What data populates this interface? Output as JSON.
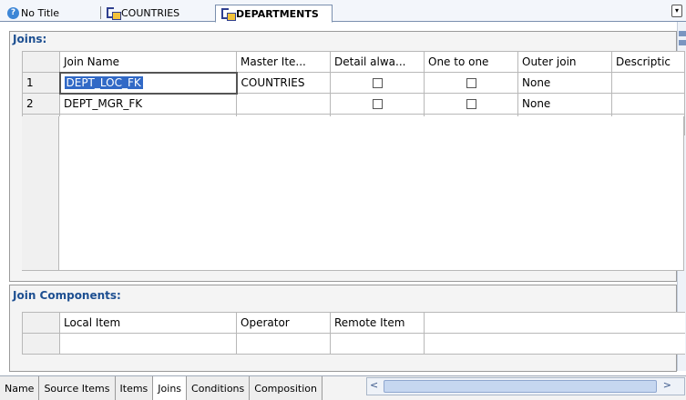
{
  "tabs": [
    {
      "label": "No Title",
      "icon": "help-icon"
    },
    {
      "label": "COUNTRIES",
      "icon": "view-icon"
    },
    {
      "label": "DEPARTMENTS",
      "icon": "view-icon",
      "active": true
    }
  ],
  "joins": {
    "title": "Joins:",
    "columns": [
      "Join Name",
      "Master Ite...",
      "Detail alwa...",
      "One to one",
      "Outer join",
      "Descriptic"
    ],
    "rows": [
      {
        "num": "1",
        "join_name": "DEPT_LOC_FK",
        "master": "COUNTRIES",
        "detail_always": false,
        "one_to_one": false,
        "outer_join": "None",
        "description": ""
      },
      {
        "num": "2",
        "join_name": "DEPT_MGR_FK",
        "master": "",
        "detail_always": false,
        "one_to_one": false,
        "outer_join": "None",
        "description": ""
      },
      {
        "num": "",
        "join_name": "",
        "master": "",
        "detail_always": false,
        "one_to_one": false,
        "outer_join": "",
        "description": ""
      }
    ]
  },
  "join_components": {
    "title": "Join Components:",
    "columns": [
      "Local Item",
      "Operator",
      "Remote Item"
    ]
  },
  "bottom_tabs": [
    "Name",
    "Source Items",
    "Items",
    "Joins",
    "Conditions",
    "Composition"
  ],
  "active_bottom_tab": "Joins",
  "colors": {
    "accent": "#1d4f91",
    "selection": "#3169c6"
  }
}
